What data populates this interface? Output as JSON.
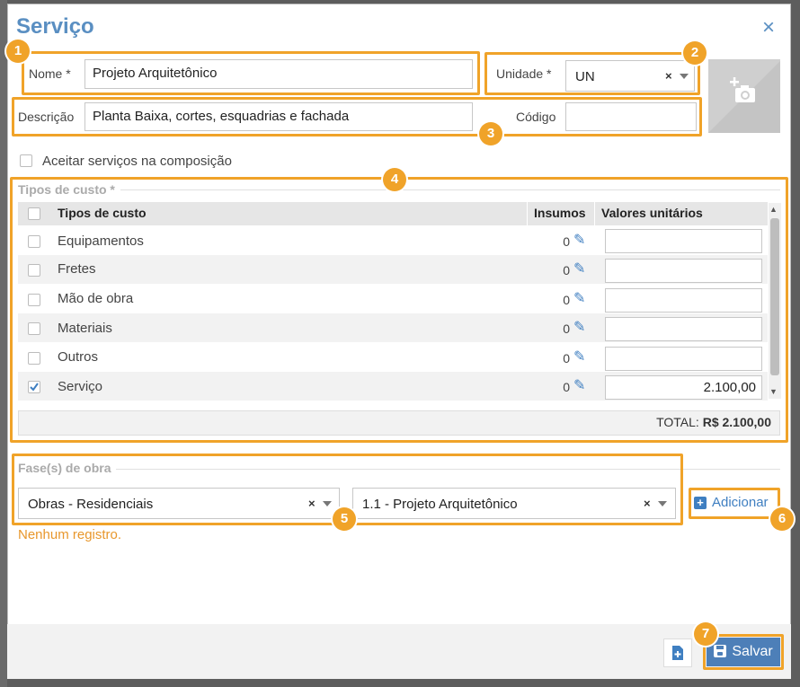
{
  "dialog": {
    "title": "Serviço",
    "close_icon": "×"
  },
  "form": {
    "nome_label": "Nome *",
    "nome_value": "Projeto Arquitetônico",
    "unidade_label": "Unidade *",
    "unidade_value": "UN",
    "descricao_label": "Descrição",
    "descricao_value": "Planta Baixa, cortes, esquadrias e fachada",
    "codigo_label": "Código",
    "codigo_value": "",
    "aceitar_label": "Aceitar serviços na composição"
  },
  "tipos": {
    "section_label": "Tipos de custo *",
    "headers": {
      "tipo": "Tipos de custo",
      "insumos": "Insumos",
      "valores": "Valores unitários"
    },
    "rows": [
      {
        "label": "Equipamentos",
        "insumos": "0",
        "valor": "",
        "checked": false
      },
      {
        "label": "Fretes",
        "insumos": "0",
        "valor": "",
        "checked": false
      },
      {
        "label": "Mão de obra",
        "insumos": "0",
        "valor": "",
        "checked": false
      },
      {
        "label": "Materiais",
        "insumos": "0",
        "valor": "",
        "checked": false
      },
      {
        "label": "Outros",
        "insumos": "0",
        "valor": "",
        "checked": false
      },
      {
        "label": "Serviço",
        "insumos": "0",
        "valor": "2.100,00",
        "checked": true
      }
    ],
    "total_label": "TOTAL:",
    "total_value": "R$ 2.100,00"
  },
  "fases": {
    "section_label": "Fase(s) de obra",
    "fase1_value": "Obras - Residenciais",
    "fase2_value": "1.1 - Projeto Arquitetônico",
    "adicionar_label": "Adicionar",
    "empty_text": "Nenhum registro."
  },
  "footer": {
    "save_label": "Salvar"
  },
  "badges": [
    "1",
    "2",
    "3",
    "4",
    "5",
    "6",
    "7"
  ],
  "colors": {
    "accent": "#f0a329",
    "primary": "#4d7fb8",
    "title": "#5a8fc2"
  }
}
